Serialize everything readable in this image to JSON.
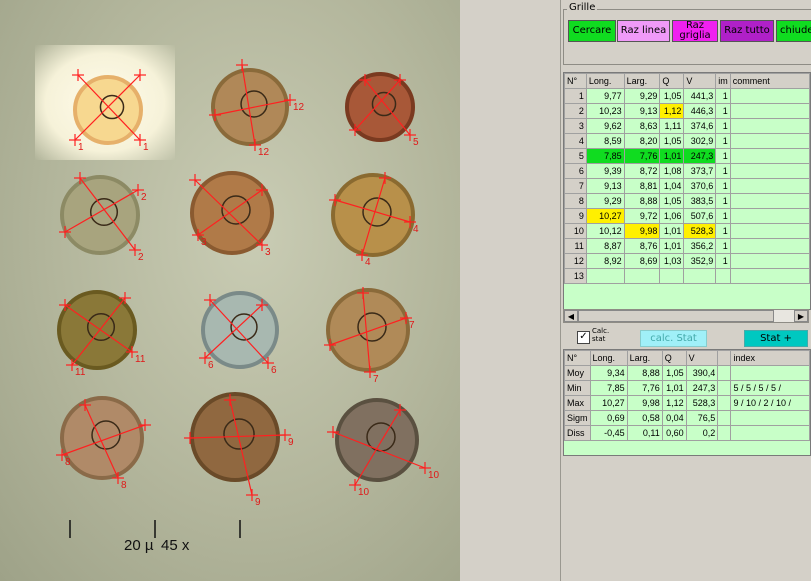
{
  "image": {
    "scale_value": "20 µ",
    "scale_mag": "45 x",
    "spore_labels": [
      "1",
      "1",
      "12",
      "12",
      "5",
      "2",
      "2",
      "3",
      "3",
      "4",
      "4",
      "11",
      "11",
      "6",
      "6",
      "7",
      "7",
      "8",
      "8",
      "9",
      "9",
      "10",
      "10"
    ]
  },
  "grille": {
    "title": "Grille",
    "buttons": {
      "cercare": "Cercare",
      "raz_linea": "Raz linea",
      "raz_griglia": "Raz griglia",
      "raz_tutto": "Raz tutto",
      "chiude": "chiude"
    }
  },
  "table": {
    "headers": [
      "N°",
      "Long.",
      "Larg.",
      "Q",
      "V",
      "im",
      "comment"
    ],
    "rows": [
      {
        "n": "1",
        "long": "9,77",
        "larg": "9,29",
        "q": "1,05",
        "v": "441,3",
        "im": "1",
        "hl": ""
      },
      {
        "n": "2",
        "long": "10,23",
        "larg": "9,13",
        "q": "1,12",
        "v": "446,3",
        "im": "1",
        "hl": "q"
      },
      {
        "n": "3",
        "long": "9,62",
        "larg": "8,63",
        "q": "1,11",
        "v": "374,6",
        "im": "1",
        "hl": ""
      },
      {
        "n": "4",
        "long": "8,59",
        "larg": "8,20",
        "q": "1,05",
        "v": "302,9",
        "im": "1",
        "hl": ""
      },
      {
        "n": "5",
        "long": "7,85",
        "larg": "7,76",
        "q": "1,01",
        "v": "247,3",
        "im": "1",
        "hl": "row"
      },
      {
        "n": "6",
        "long": "9,39",
        "larg": "8,72",
        "q": "1,08",
        "v": "373,7",
        "im": "1",
        "hl": ""
      },
      {
        "n": "7",
        "long": "9,13",
        "larg": "8,81",
        "q": "1,04",
        "v": "370,6",
        "im": "1",
        "hl": ""
      },
      {
        "n": "8",
        "long": "9,29",
        "larg": "8,88",
        "q": "1,05",
        "v": "383,5",
        "im": "1",
        "hl": ""
      },
      {
        "n": "9",
        "long": "10,27",
        "larg": "9,72",
        "q": "1,06",
        "v": "507,6",
        "im": "1",
        "hl": "long"
      },
      {
        "n": "10",
        "long": "10,12",
        "larg": "9,98",
        "q": "1,01",
        "v": "528,3",
        "im": "1",
        "hl": "larg_v"
      },
      {
        "n": "11",
        "long": "8,87",
        "larg": "8,76",
        "q": "1,01",
        "v": "356,2",
        "im": "1",
        "hl": ""
      },
      {
        "n": "12",
        "long": "8,92",
        "larg": "8,69",
        "q": "1,03",
        "v": "352,9",
        "im": "1",
        "hl": ""
      },
      {
        "n": "13",
        "long": "",
        "larg": "",
        "q": "",
        "v": "",
        "im": "",
        "hl": ""
      }
    ]
  },
  "controls": {
    "checkbox_label": "Calc. stat",
    "checkbox_checked": "✓",
    "calc_button": "calc. Stat",
    "stat_button": "Stat +"
  },
  "stats": {
    "headers": [
      "N°",
      "Long.",
      "Larg.",
      "Q",
      "V",
      "",
      "index"
    ],
    "rows": [
      {
        "label": "Moy",
        "long": "9,34",
        "larg": "8,88",
        "q": "1,05",
        "v": "390,4",
        "index": ""
      },
      {
        "label": "Min",
        "long": "7,85",
        "larg": "7,76",
        "q": "1,01",
        "v": "247,3",
        "index": "5 / 5 / 5 / 5 /"
      },
      {
        "label": "Max",
        "long": "10,27",
        "larg": "9,98",
        "q": "1,12",
        "v": "528,3",
        "index": "9 / 10 / 2 / 10 /"
      },
      {
        "label": "Sigm",
        "long": "0,69",
        "larg": "0,58",
        "q": "0,04",
        "v": "76,5",
        "index": ""
      },
      {
        "label": "Diss",
        "long": "-0,45",
        "larg": "0,11",
        "q": "0,60",
        "v": "0,2",
        "index": ""
      }
    ]
  }
}
